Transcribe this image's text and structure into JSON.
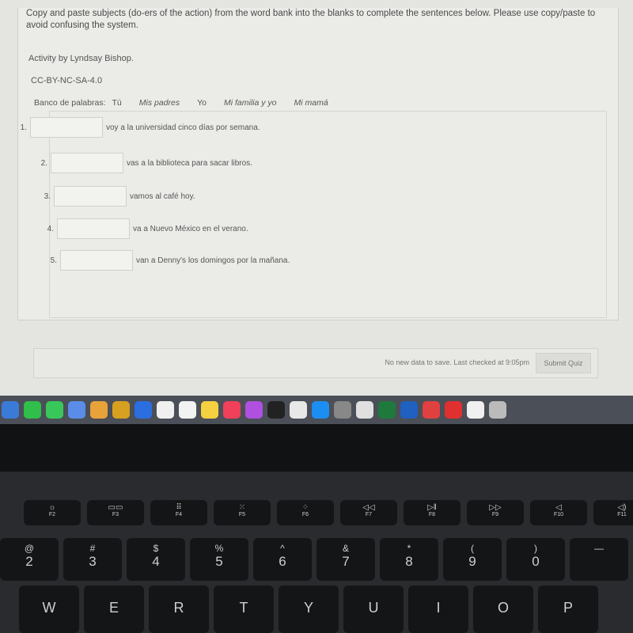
{
  "quiz": {
    "instructions": "Copy and paste subjects (do-ers of the action) from the word bank into the blanks to complete the sentences below.  Please use copy/paste to avoid confusing the system.",
    "author": "Activity by Lyndsay Bishop.",
    "license": "CC-BY-NC-SA-4.0",
    "word_bank_label": "Banco de palabras:",
    "word_bank": [
      "Tú",
      "Mis padres",
      "Yo",
      "Mi familia y yo",
      "Mi mamá"
    ],
    "questions": [
      {
        "number": "1.",
        "value": "",
        "text": "voy a la universidad cinco días por semana."
      },
      {
        "number": "2.",
        "value": "",
        "text": "vas a la biblioteca para sacar libros."
      },
      {
        "number": "3.",
        "value": "",
        "text": "vamos al café hoy."
      },
      {
        "number": "4.",
        "value": "",
        "text": "va a Nuevo México en el verano."
      },
      {
        "number": "5.",
        "value": "",
        "text": "van a Denny's los domingos por la mañana."
      }
    ],
    "status": "No new data to save. Last checked at 9:05pm",
    "submit_label": "Submit Quiz"
  },
  "dock": {
    "colors": [
      "#3b7bd8",
      "#2fbf4a",
      "#38c85a",
      "#5a8de8",
      "#e8a23a",
      "#d8a020",
      "#2a6ee0",
      "#f0f0f0",
      "#f2f2f2",
      "#f5d040",
      "#f0405a",
      "#b050e0",
      "#222222",
      "#e8e8e8",
      "#1c8ef2",
      "#888888",
      "#e0e0e0",
      "#1e7a3c",
      "#2060c0",
      "#e04040",
      "#e03030",
      "#f0f0f0",
      "#bbbbbb"
    ]
  },
  "keyboard": {
    "fn": [
      {
        "icon": "brightness-up",
        "label": "F2"
      },
      {
        "icon": "mission-control",
        "label": "F3"
      },
      {
        "icon": "launchpad",
        "label": "F4"
      },
      {
        "icon": "keyboard-dim",
        "label": "F5"
      },
      {
        "icon": "keyboard-bright",
        "label": "F6"
      },
      {
        "icon": "rewind",
        "label": "F7"
      },
      {
        "icon": "play-pause",
        "label": "F8"
      },
      {
        "icon": "fast-forward",
        "label": "F9"
      },
      {
        "icon": "mute",
        "label": "F10"
      },
      {
        "icon": "volume-down",
        "label": "F11"
      }
    ],
    "fn_glyphs": [
      "☼",
      "▭▭",
      "⠿",
      "⁙",
      "⁘",
      "◁◁",
      "▷‖",
      "▷▷",
      "◁",
      "◁)"
    ],
    "numbers": [
      [
        "@",
        "2"
      ],
      [
        "#",
        "3"
      ],
      [
        "$",
        "4"
      ],
      [
        "%",
        "5"
      ],
      [
        "^",
        "6"
      ],
      [
        "&",
        "7"
      ],
      [
        "*",
        "8"
      ],
      [
        "(",
        "9"
      ],
      [
        ")",
        "0"
      ],
      [
        "—",
        ""
      ]
    ],
    "letters": [
      "W",
      "E",
      "R",
      "T",
      "Y",
      "U",
      "I",
      "O",
      "P"
    ]
  }
}
